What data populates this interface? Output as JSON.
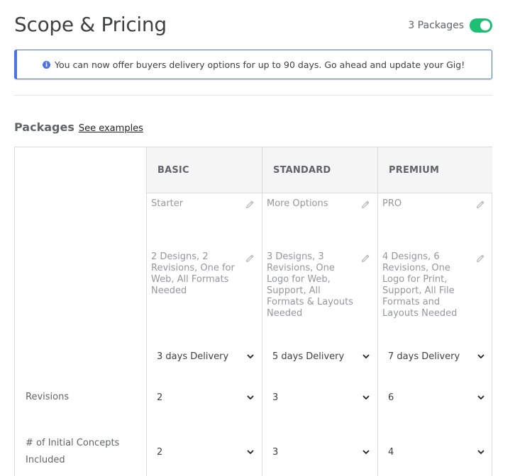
{
  "page": {
    "title": "Scope & Pricing",
    "packages_toggle_label": "3 Packages",
    "packages_toggle_on": true
  },
  "notice": {
    "text": "You can now offer buyers delivery options for up to 90 days. Go ahead and update your Gig!"
  },
  "packages_section": {
    "title": "Packages",
    "see_examples": "See examples"
  },
  "colors": {
    "accent_green": "#1dbf73",
    "notice_blue": "#4a73e8"
  },
  "rows": {
    "revisions_label": "Revisions",
    "concepts_label": "# of Initial Concepts Included"
  },
  "packages": [
    {
      "header": "BASIC",
      "name": "Starter",
      "description": "2 Designs, 2 Revisions, One for Web, All Formats Needed",
      "delivery": "3 days Delivery",
      "revisions": "2",
      "concepts": "2"
    },
    {
      "header": "STANDARD",
      "name": "More Options",
      "description": "3 Designs, 3 Revisions, One Logo for Web, Support, All Formats & Layouts Needed",
      "delivery": "5 days Delivery",
      "revisions": "3",
      "concepts": "3"
    },
    {
      "header": "PREMIUM",
      "name": "PRO",
      "description": "4 Designs, 6 Revisions, One Logo for Print, Support, All File Formats and Layouts Needed",
      "delivery": "7 days Delivery",
      "revisions": "6",
      "concepts": "4"
    }
  ]
}
